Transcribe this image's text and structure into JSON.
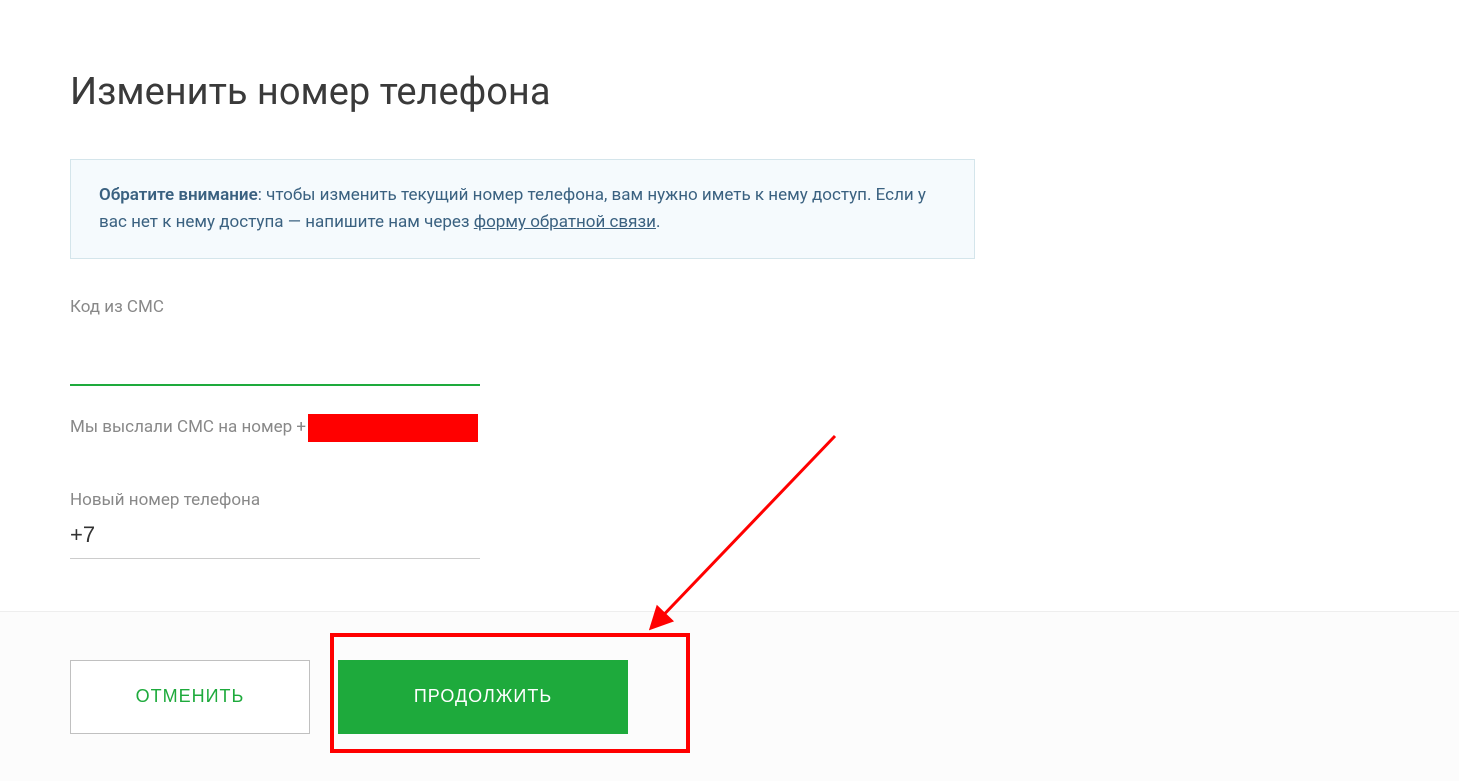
{
  "title": "Изменить номер телефона",
  "info": {
    "bold": "Обратите внимание",
    "text1": ": чтобы изменить текущий номер телефона, вам нужно иметь к нему доступ. Если у вас нет к нему доступа — напишите нам через ",
    "link": "форму обратной связи",
    "text2": "."
  },
  "sms_code": {
    "label": "Код из СМС",
    "value": ""
  },
  "sms_sent": {
    "prefix": "Мы выслали СМС на номер +"
  },
  "new_phone": {
    "label": "Новый номер телефона",
    "value": "+7"
  },
  "buttons": {
    "cancel": "ОТМЕНИТЬ",
    "continue": "ПРОДОЛЖИТЬ"
  }
}
